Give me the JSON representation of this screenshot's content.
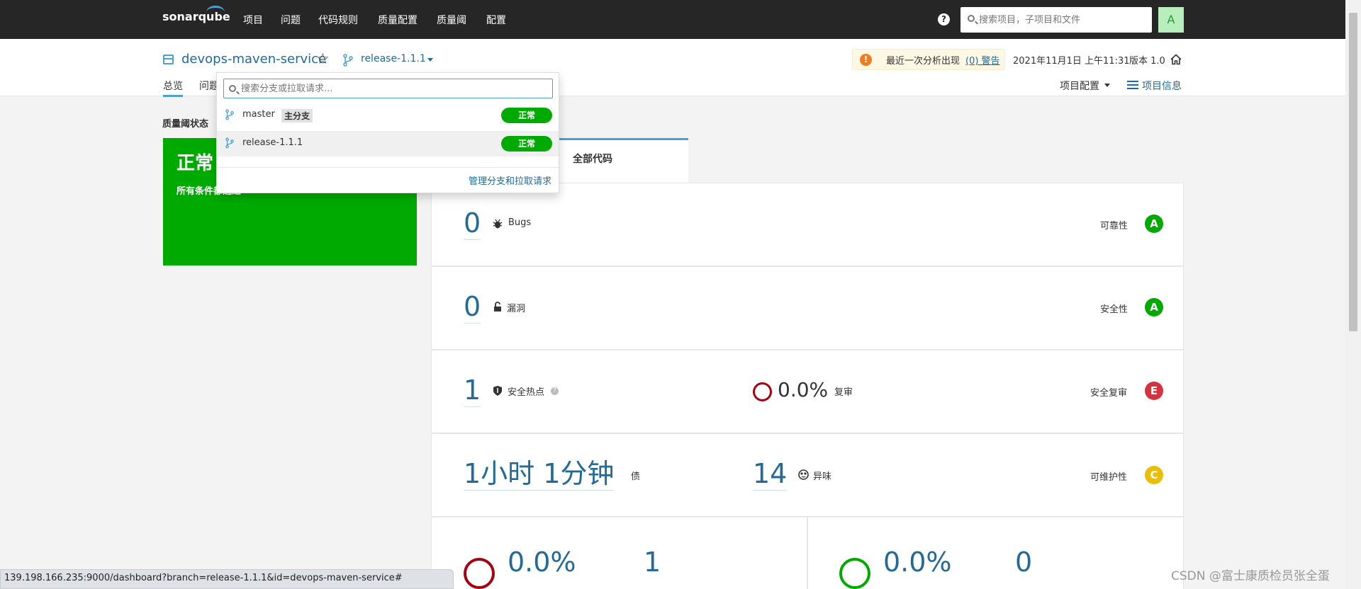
{
  "topnav": {
    "brand_a": "sonar",
    "brand_b": "qube",
    "items": [
      "项目",
      "问题",
      "代码规则",
      "质量配置",
      "质量阈",
      "配置"
    ],
    "search_placeholder": "搜索项目，子项目和文件",
    "avatar": "A"
  },
  "project": {
    "name": "devops-maven-service",
    "branch": "release-1.1.1",
    "tabs": [
      "总览",
      "问题"
    ],
    "warning_text": "最近一次分析出现",
    "warning_link": "(0) 警告",
    "date": "2021年11月1日 上午11:31",
    "version": "版本 1.0",
    "config": "项目配置",
    "info": "项目信息"
  },
  "quality_gate": {
    "label": "质量阈状态",
    "status": "正常",
    "desc": "所有条件都通过"
  },
  "code_tab": "全部代码",
  "metrics": [
    {
      "value": "0",
      "label": "Bugs",
      "rating_label": "可靠性",
      "rating": "A"
    },
    {
      "value": "0",
      "label": "漏洞",
      "rating_label": "安全性",
      "rating": "A"
    },
    {
      "value": "1",
      "label": "安全热点",
      "mid_value": "0.0%",
      "mid_label": "复审",
      "rating_label": "安全复审",
      "rating": "E"
    },
    {
      "value": "1小时 1分钟",
      "label": "债",
      "mid_value": "14",
      "mid_label": "异味",
      "rating_label": "可维护性",
      "rating": "C"
    }
  ],
  "coverage": {
    "left_pct": "0.0%",
    "left_count": "1",
    "right_pct": "0.0%",
    "right_count": "0"
  },
  "dropdown": {
    "placeholder": "搜索分支或拉取请求...",
    "branches": [
      {
        "name": "master",
        "badge": "主分支",
        "status": "正常"
      },
      {
        "name": "release-1.1.1",
        "status": "正常"
      }
    ],
    "manage": "管理分支和拉取请求"
  },
  "statusbar_url": "139.198.166.235:9000/dashboard?branch=release-1.1.1&id=devops-maven-service#",
  "watermark": "CSDN @富士康质检员张全蛋",
  "colors": {
    "rating_A": "#00aa00",
    "rating_C": "#eabe06",
    "rating_E": "#d4333f",
    "ok": "#00aa00",
    "link": "#236a97",
    "accent": "#4b9fd5"
  }
}
